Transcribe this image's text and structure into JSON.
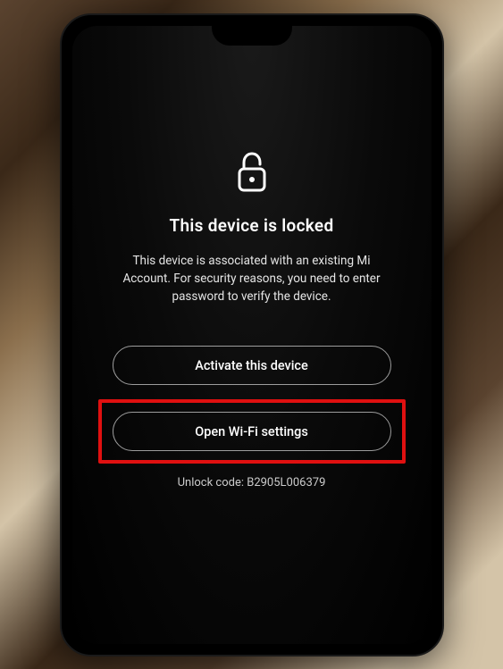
{
  "lockScreen": {
    "title": "This device is locked",
    "message": "This device is associated with an existing Mi Account. For security reasons, you need to enter password to verify the device.",
    "activateButton": "Activate this device",
    "wifiButton": "Open Wi-Fi settings",
    "unlockCodeLabel": "Unlock code: B2905L006379"
  }
}
